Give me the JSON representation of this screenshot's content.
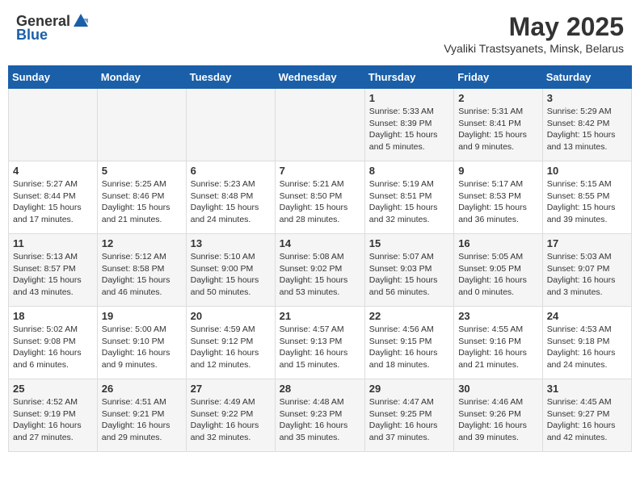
{
  "header": {
    "logo_general": "General",
    "logo_blue": "Blue",
    "month_title": "May 2025",
    "location": "Vyaliki Trastsyanets, Minsk, Belarus"
  },
  "days_of_week": [
    "Sunday",
    "Monday",
    "Tuesday",
    "Wednesday",
    "Thursday",
    "Friday",
    "Saturday"
  ],
  "weeks": [
    [
      {
        "day": "",
        "sunrise": "",
        "sunset": "",
        "daylight": ""
      },
      {
        "day": "",
        "sunrise": "",
        "sunset": "",
        "daylight": ""
      },
      {
        "day": "",
        "sunrise": "",
        "sunset": "",
        "daylight": ""
      },
      {
        "day": "",
        "sunrise": "",
        "sunset": "",
        "daylight": ""
      },
      {
        "day": "1",
        "sunrise": "Sunrise: 5:33 AM",
        "sunset": "Sunset: 8:39 PM",
        "daylight": "Daylight: 15 hours and 5 minutes."
      },
      {
        "day": "2",
        "sunrise": "Sunrise: 5:31 AM",
        "sunset": "Sunset: 8:41 PM",
        "daylight": "Daylight: 15 hours and 9 minutes."
      },
      {
        "day": "3",
        "sunrise": "Sunrise: 5:29 AM",
        "sunset": "Sunset: 8:42 PM",
        "daylight": "Daylight: 15 hours and 13 minutes."
      }
    ],
    [
      {
        "day": "4",
        "sunrise": "Sunrise: 5:27 AM",
        "sunset": "Sunset: 8:44 PM",
        "daylight": "Daylight: 15 hours and 17 minutes."
      },
      {
        "day": "5",
        "sunrise": "Sunrise: 5:25 AM",
        "sunset": "Sunset: 8:46 PM",
        "daylight": "Daylight: 15 hours and 21 minutes."
      },
      {
        "day": "6",
        "sunrise": "Sunrise: 5:23 AM",
        "sunset": "Sunset: 8:48 PM",
        "daylight": "Daylight: 15 hours and 24 minutes."
      },
      {
        "day": "7",
        "sunrise": "Sunrise: 5:21 AM",
        "sunset": "Sunset: 8:50 PM",
        "daylight": "Daylight: 15 hours and 28 minutes."
      },
      {
        "day": "8",
        "sunrise": "Sunrise: 5:19 AM",
        "sunset": "Sunset: 8:51 PM",
        "daylight": "Daylight: 15 hours and 32 minutes."
      },
      {
        "day": "9",
        "sunrise": "Sunrise: 5:17 AM",
        "sunset": "Sunset: 8:53 PM",
        "daylight": "Daylight: 15 hours and 36 minutes."
      },
      {
        "day": "10",
        "sunrise": "Sunrise: 5:15 AM",
        "sunset": "Sunset: 8:55 PM",
        "daylight": "Daylight: 15 hours and 39 minutes."
      }
    ],
    [
      {
        "day": "11",
        "sunrise": "Sunrise: 5:13 AM",
        "sunset": "Sunset: 8:57 PM",
        "daylight": "Daylight: 15 hours and 43 minutes."
      },
      {
        "day": "12",
        "sunrise": "Sunrise: 5:12 AM",
        "sunset": "Sunset: 8:58 PM",
        "daylight": "Daylight: 15 hours and 46 minutes."
      },
      {
        "day": "13",
        "sunrise": "Sunrise: 5:10 AM",
        "sunset": "Sunset: 9:00 PM",
        "daylight": "Daylight: 15 hours and 50 minutes."
      },
      {
        "day": "14",
        "sunrise": "Sunrise: 5:08 AM",
        "sunset": "Sunset: 9:02 PM",
        "daylight": "Daylight: 15 hours and 53 minutes."
      },
      {
        "day": "15",
        "sunrise": "Sunrise: 5:07 AM",
        "sunset": "Sunset: 9:03 PM",
        "daylight": "Daylight: 15 hours and 56 minutes."
      },
      {
        "day": "16",
        "sunrise": "Sunrise: 5:05 AM",
        "sunset": "Sunset: 9:05 PM",
        "daylight": "Daylight: 16 hours and 0 minutes."
      },
      {
        "day": "17",
        "sunrise": "Sunrise: 5:03 AM",
        "sunset": "Sunset: 9:07 PM",
        "daylight": "Daylight: 16 hours and 3 minutes."
      }
    ],
    [
      {
        "day": "18",
        "sunrise": "Sunrise: 5:02 AM",
        "sunset": "Sunset: 9:08 PM",
        "daylight": "Daylight: 16 hours and 6 minutes."
      },
      {
        "day": "19",
        "sunrise": "Sunrise: 5:00 AM",
        "sunset": "Sunset: 9:10 PM",
        "daylight": "Daylight: 16 hours and 9 minutes."
      },
      {
        "day": "20",
        "sunrise": "Sunrise: 4:59 AM",
        "sunset": "Sunset: 9:12 PM",
        "daylight": "Daylight: 16 hours and 12 minutes."
      },
      {
        "day": "21",
        "sunrise": "Sunrise: 4:57 AM",
        "sunset": "Sunset: 9:13 PM",
        "daylight": "Daylight: 16 hours and 15 minutes."
      },
      {
        "day": "22",
        "sunrise": "Sunrise: 4:56 AM",
        "sunset": "Sunset: 9:15 PM",
        "daylight": "Daylight: 16 hours and 18 minutes."
      },
      {
        "day": "23",
        "sunrise": "Sunrise: 4:55 AM",
        "sunset": "Sunset: 9:16 PM",
        "daylight": "Daylight: 16 hours and 21 minutes."
      },
      {
        "day": "24",
        "sunrise": "Sunrise: 4:53 AM",
        "sunset": "Sunset: 9:18 PM",
        "daylight": "Daylight: 16 hours and 24 minutes."
      }
    ],
    [
      {
        "day": "25",
        "sunrise": "Sunrise: 4:52 AM",
        "sunset": "Sunset: 9:19 PM",
        "daylight": "Daylight: 16 hours and 27 minutes."
      },
      {
        "day": "26",
        "sunrise": "Sunrise: 4:51 AM",
        "sunset": "Sunset: 9:21 PM",
        "daylight": "Daylight: 16 hours and 29 minutes."
      },
      {
        "day": "27",
        "sunrise": "Sunrise: 4:49 AM",
        "sunset": "Sunset: 9:22 PM",
        "daylight": "Daylight: 16 hours and 32 minutes."
      },
      {
        "day": "28",
        "sunrise": "Sunrise: 4:48 AM",
        "sunset": "Sunset: 9:23 PM",
        "daylight": "Daylight: 16 hours and 35 minutes."
      },
      {
        "day": "29",
        "sunrise": "Sunrise: 4:47 AM",
        "sunset": "Sunset: 9:25 PM",
        "daylight": "Daylight: 16 hours and 37 minutes."
      },
      {
        "day": "30",
        "sunrise": "Sunrise: 4:46 AM",
        "sunset": "Sunset: 9:26 PM",
        "daylight": "Daylight: 16 hours and 39 minutes."
      },
      {
        "day": "31",
        "sunrise": "Sunrise: 4:45 AM",
        "sunset": "Sunset: 9:27 PM",
        "daylight": "Daylight: 16 hours and 42 minutes."
      }
    ]
  ]
}
